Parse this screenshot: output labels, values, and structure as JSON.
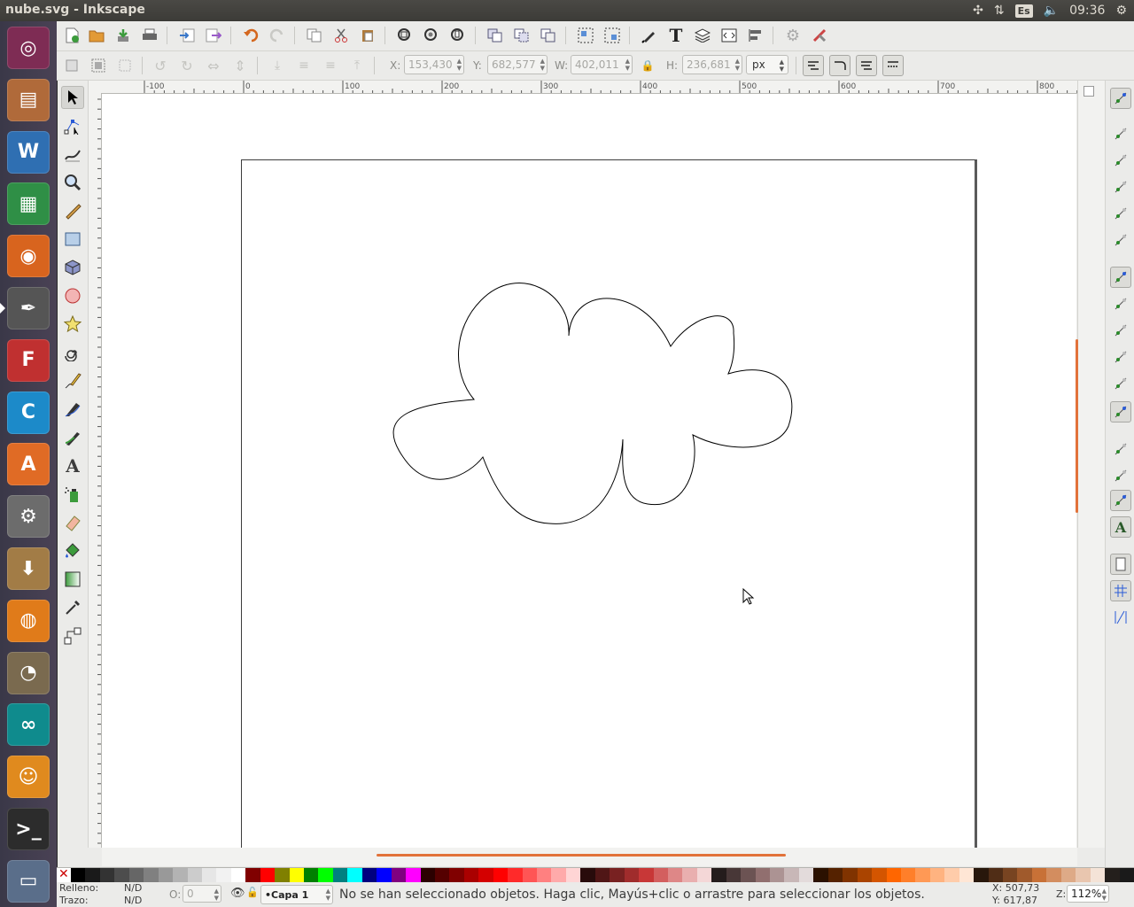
{
  "window": {
    "title": "nube.svg - Inkscape"
  },
  "tray": {
    "language": "Es",
    "time": "09:36"
  },
  "launcher": {
    "items": [
      {
        "name": "ubuntu-dash-icon",
        "glyph": "◎",
        "color": "#7e2c54"
      },
      {
        "name": "files-icon",
        "glyph": "▤",
        "color": "#b06a3a"
      },
      {
        "name": "writer-icon",
        "glyph": "W",
        "color": "#2f6fb2"
      },
      {
        "name": "calc-icon",
        "glyph": "▦",
        "color": "#2f8f46"
      },
      {
        "name": "firefox-icon",
        "glyph": "◉",
        "color": "#d8641e"
      },
      {
        "name": "inkscape-icon",
        "glyph": "✒",
        "color": "#555555"
      },
      {
        "name": "fontforge-icon",
        "glyph": "F",
        "color": "#c03030"
      },
      {
        "name": "ccleaner-icon",
        "glyph": "C",
        "color": "#1c8ac9"
      },
      {
        "name": "software-center-icon",
        "glyph": "A",
        "color": "#e06b25"
      },
      {
        "name": "settings-icon",
        "glyph": "⚙",
        "color": "#6c6c6c"
      },
      {
        "name": "archive-icon",
        "glyph": "⬇",
        "color": "#a27c46"
      },
      {
        "name": "blender-icon",
        "glyph": "◍",
        "color": "#e07b1a"
      },
      {
        "name": "gimp-icon",
        "glyph": "◔",
        "color": "#7a6a4f"
      },
      {
        "name": "arduino-icon",
        "glyph": "∞",
        "color": "#0f8b8d"
      },
      {
        "name": "scratch-icon",
        "glyph": "☺",
        "color": "#e08a1e"
      },
      {
        "name": "terminal-icon",
        "glyph": ">_",
        "color": "#2c2c2c"
      },
      {
        "name": "scanner-icon",
        "glyph": "▭",
        "color": "#5a6e8a"
      }
    ]
  },
  "controls": {
    "x_label": "X:",
    "x_value": "153,430",
    "y_label": "Y:",
    "y_value": "682,577",
    "w_label": "W:",
    "w_value": "402,011",
    "h_label": "H:",
    "h_value": "236,681",
    "unit": "px"
  },
  "ruler": {
    "h_ticks": [
      "-100",
      "0",
      "100",
      "200",
      "300",
      "400",
      "500",
      "600",
      "700",
      "800"
    ]
  },
  "status": {
    "fill_label": "Relleno:",
    "fill_value": "N/D",
    "stroke_label": "Trazo:",
    "stroke_value": "N/D",
    "opacity_label": "O:",
    "opacity_value": "0",
    "layer": "•Capa 1",
    "message": "No se han seleccionado objetos. Haga clic, Mayús+clic o arrastre para seleccionar los objetos.",
    "x_coord": "X: 507,73",
    "y_coord": "Y: 617,87",
    "zoom_label": "Z:",
    "zoom_value": "112%"
  },
  "colors": {
    "accent": "#e2723a",
    "palette": [
      "#000000",
      "#1a1a1a",
      "#333333",
      "#4d4d4d",
      "#666666",
      "#808080",
      "#999999",
      "#b3b3b3",
      "#cccccc",
      "#e6e6e6",
      "#f2f2f2",
      "#ffffff",
      "#800000",
      "#ff0000",
      "#808000",
      "#ffff00",
      "#008000",
      "#00ff00",
      "#008080",
      "#00ffff",
      "#000080",
      "#0000ff",
      "#800080",
      "#ff00ff",
      "#2b0000",
      "#550000",
      "#800000",
      "#aa0000",
      "#d40000",
      "#ff0000",
      "#ff2a2a",
      "#ff5555",
      "#ff8080",
      "#ffaaaa",
      "#ffd5d5",
      "#280b0b",
      "#501616",
      "#782121",
      "#a02c2c",
      "#c83737",
      "#d35f5f",
      "#de8787",
      "#e9afaf",
      "#f4d7d7",
      "#241c1c",
      "#483737",
      "#6c5353",
      "#916f6f",
      "#ac9393",
      "#c8b7b7",
      "#e3dbdb",
      "#2b1100",
      "#552200",
      "#803300",
      "#aa4400",
      "#d45500",
      "#ff6600",
      "#ff7f2a",
      "#ff9955",
      "#ffb380",
      "#ffccaa",
      "#ffe6d5",
      "#28170b",
      "#502d16",
      "#784421",
      "#a05a2c",
      "#c87137",
      "#d38d5f",
      "#deaa87",
      "#e9c6af",
      "#f4e3d7",
      "#241f1c",
      "#1a1a1a"
    ]
  }
}
